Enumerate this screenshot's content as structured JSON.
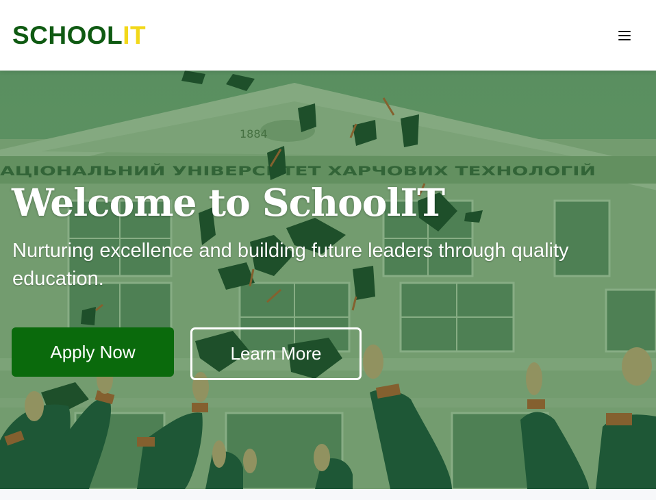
{
  "brand": {
    "part1": "SCHOOL",
    "part2": "IT"
  },
  "header": {
    "menu_icon": "hamburger-menu-icon"
  },
  "hero": {
    "title": "Welcome to SchoolIT",
    "subtitle": "Nurturing excellence and building future leaders through quality education.",
    "building_sign": "АЦІОНАЛЬНИЙ УНІВЕРСИТЕТ ХАРЧОВИХ ТЕХНОЛОГІЙ",
    "building_year": "1884"
  },
  "buttons": {
    "apply": "Apply Now",
    "learn": "Learn More"
  },
  "colors": {
    "brand_green": "#0f5a12",
    "brand_yellow": "#f2d81a",
    "primary_button": "#0a6a0c",
    "overlay": "#1e6e1e"
  }
}
